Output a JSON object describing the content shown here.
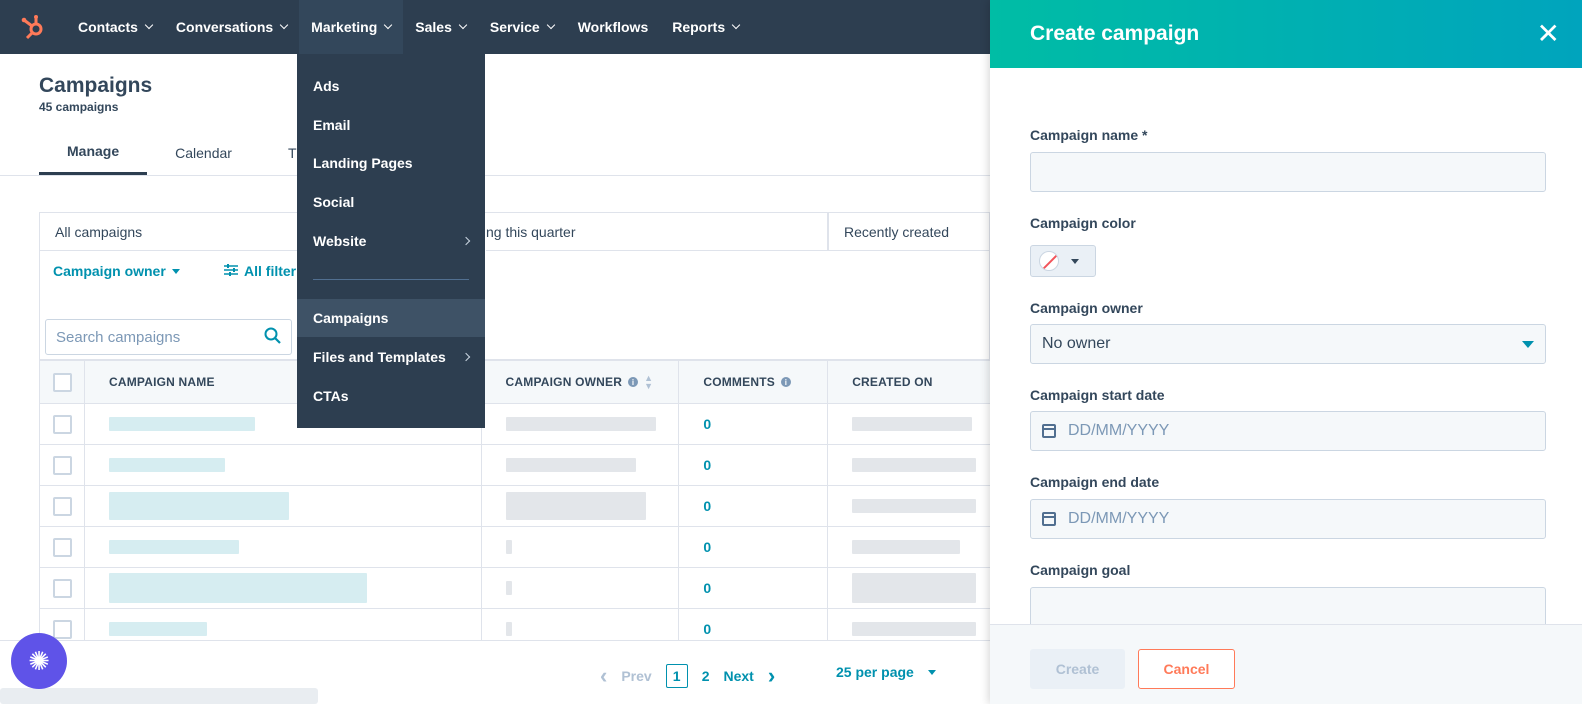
{
  "nav": {
    "items": [
      {
        "label": "Contacts",
        "has_chevron": true
      },
      {
        "label": "Conversations",
        "has_chevron": true
      },
      {
        "label": "Marketing",
        "has_chevron": true,
        "active": true
      },
      {
        "label": "Sales",
        "has_chevron": true
      },
      {
        "label": "Service",
        "has_chevron": true
      },
      {
        "label": "Workflows",
        "has_chevron": false
      },
      {
        "label": "Reports",
        "has_chevron": true
      }
    ]
  },
  "page": {
    "title": "Campaigns",
    "count": "45 campaigns",
    "tabs": [
      {
        "label": "Manage",
        "active": true
      },
      {
        "label": "Calendar",
        "active": false
      },
      {
        "label": "T",
        "active": false
      }
    ]
  },
  "views": {
    "all": "All campaigns",
    "quarter": "ng this quarter",
    "recent": "Recently created"
  },
  "filters": {
    "owner": "Campaign owner",
    "all_filters": "All filter"
  },
  "search": {
    "placeholder": "Search campaigns"
  },
  "table": {
    "columns": {
      "name": "CAMPAIGN NAME",
      "owner": "CAMPAIGN OWNER",
      "comments": "COMMENTS",
      "created": "CREATED ON"
    },
    "rows": [
      {
        "comments": "0"
      },
      {
        "comments": "0"
      },
      {
        "comments": "0"
      },
      {
        "comments": "0"
      },
      {
        "comments": "0"
      },
      {
        "comments": "0"
      }
    ]
  },
  "pager": {
    "prev": "Prev",
    "current": "1",
    "page2": "2",
    "next": "Next",
    "per_page": "25 per page"
  },
  "menu": {
    "items": [
      {
        "label": "Ads",
        "submenu": false
      },
      {
        "label": "Email",
        "submenu": false
      },
      {
        "label": "Landing Pages",
        "submenu": false
      },
      {
        "label": "Social",
        "submenu": false
      },
      {
        "label": "Website",
        "submenu": true
      },
      {
        "label": "Campaigns",
        "submenu": false,
        "active": true
      },
      {
        "label": "Files and Templates",
        "submenu": true
      },
      {
        "label": "CTAs",
        "submenu": false
      }
    ]
  },
  "panel": {
    "title": "Create campaign",
    "name_label": "Campaign name *",
    "color_label": "Campaign color",
    "owner_label": "Campaign owner",
    "owner_value": "No owner",
    "start_label": "Campaign start date",
    "start_placeholder": "DD/MM/YYYY",
    "end_label": "Campaign end date",
    "end_placeholder": "DD/MM/YYYY",
    "goal_label": "Campaign goal",
    "create": "Create",
    "cancel": "Cancel"
  },
  "colors": {
    "nav_bg": "#2d3e50",
    "accent_teal": "#0091ae",
    "header_gradient_start": "#00bda5",
    "header_gradient_end": "#00a4bd",
    "cancel_orange": "#ff7a59",
    "help_purple": "#5f53e8"
  },
  "icons": [
    "hubspot-logo-icon",
    "chevron-down-icon",
    "chevron-right-icon",
    "search-icon",
    "info-icon",
    "sort-icon",
    "calendar-icon",
    "close-icon",
    "help-icon",
    "filter-icon"
  ]
}
